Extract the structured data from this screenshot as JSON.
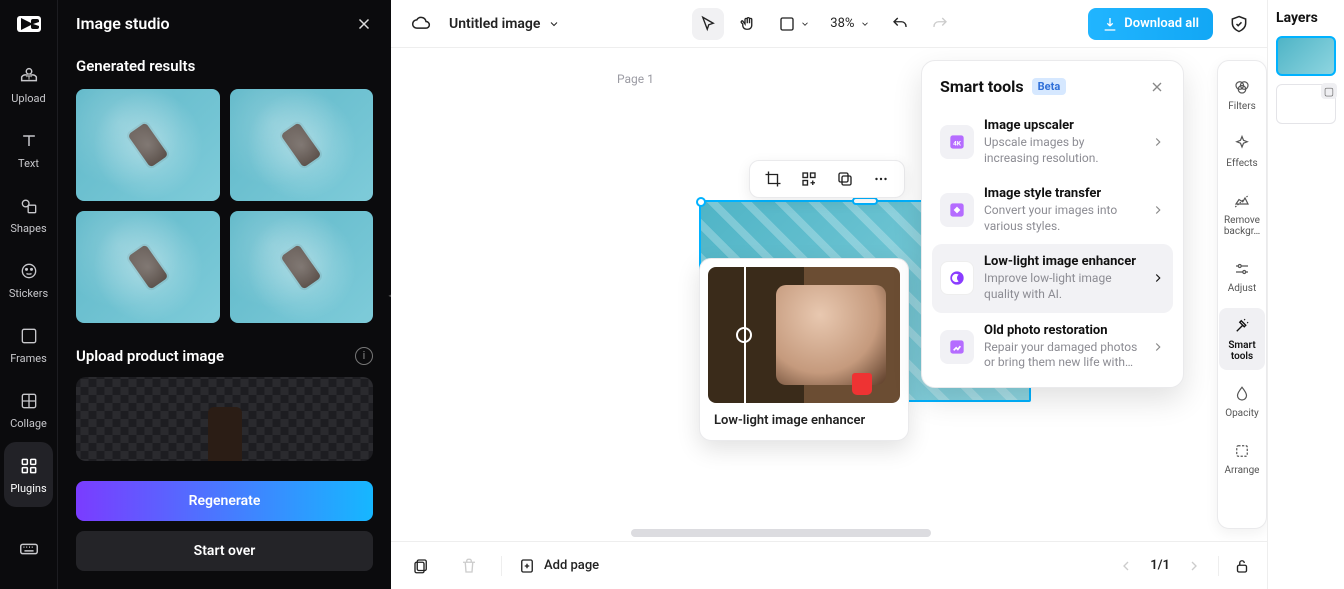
{
  "rail": {
    "items": [
      {
        "label": "Upload"
      },
      {
        "label": "Text"
      },
      {
        "label": "Shapes"
      },
      {
        "label": "Stickers"
      },
      {
        "label": "Frames"
      },
      {
        "label": "Collage"
      },
      {
        "label": "Plugins"
      }
    ]
  },
  "panel": {
    "title": "Image studio",
    "results_heading": "Generated results",
    "upload_heading": "Upload product image",
    "regenerate_label": "Regenerate",
    "startover_label": "Start over"
  },
  "topbar": {
    "doc_title": "Untitled image",
    "zoom": "38%",
    "download_label": "Download all"
  },
  "canvas": {
    "page_label": "Page 1"
  },
  "hover_card": {
    "caption": "Low-light image enhancer"
  },
  "popover": {
    "title": "Smart tools",
    "badge": "Beta",
    "items": [
      {
        "title": "Image upscaler",
        "desc": "Upscale images by increasing resolution."
      },
      {
        "title": "Image style transfer",
        "desc": "Convert your images into various styles."
      },
      {
        "title": "Low-light image enhancer",
        "desc": "Improve low-light image quality with AI."
      },
      {
        "title": "Old photo restoration",
        "desc": "Repair your damaged photos or bring them new life with…"
      }
    ]
  },
  "adjust_rail": {
    "items": [
      {
        "label": "Filters"
      },
      {
        "label": "Effects"
      },
      {
        "label": "Remove backgr…"
      },
      {
        "label": "Adjust"
      },
      {
        "label": "Smart tools"
      },
      {
        "label": "Opacity"
      },
      {
        "label": "Arrange"
      }
    ]
  },
  "bottombar": {
    "add_page": "Add page",
    "page_indicator": "1/1"
  },
  "layers": {
    "heading": "Layers"
  }
}
